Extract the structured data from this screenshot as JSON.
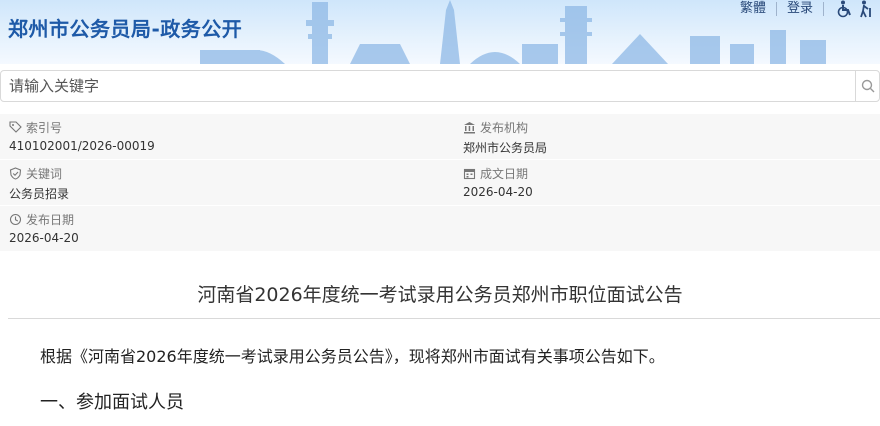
{
  "header": {
    "site_title": "郑州市公务员局-政务公开",
    "links": {
      "traditional": "繁體",
      "login": "登录"
    },
    "icons": [
      "wheelchair-icon",
      "old-person-icon"
    ]
  },
  "search": {
    "placeholder": "请输入关键字",
    "value": ""
  },
  "meta": {
    "index_no": {
      "label": "索引号",
      "value": "410102001/2026-00019"
    },
    "publisher": {
      "label": "发布机构",
      "value": "郑州市公务员局"
    },
    "keywords": {
      "label": "关键词",
      "value": "公务员招录"
    },
    "created_date": {
      "label": "成文日期",
      "value": "2026-04-20"
    },
    "publish_date": {
      "label": "发布日期",
      "value": "2026-04-20"
    }
  },
  "article": {
    "title": "河南省2026年度统一考试录用公务员郑州市职位面试公告",
    "intro": "根据《河南省2026年度统一考试录用公务员公告》，现将郑州市面试有关事项公告如下。",
    "section1": "一、参加面试人员"
  },
  "colors": {
    "brand": "#1e5aa8",
    "meta_bg": "#f7f7f7"
  }
}
